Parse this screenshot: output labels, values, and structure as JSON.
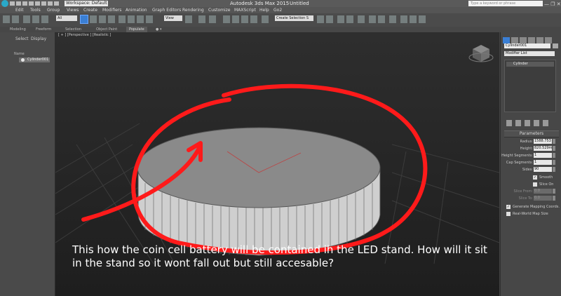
{
  "titlebar": {
    "workspace": "Workspace: Default",
    "app_title": "Autodesk 3ds Max  2015",
    "document": "Untitled",
    "search_placeholder": "Type a keyword or phrase",
    "window_controls": "— ❐ ✕"
  },
  "menu": [
    "Edit",
    "Tools",
    "Group",
    "Views",
    "Create",
    "Modifiers",
    "Animation",
    "Graph Editors",
    "Rendering",
    "Customize",
    "MAXScript",
    "Help",
    "Go2"
  ],
  "toolbar": {
    "selection_filter": "All",
    "reference_coord": "View",
    "named_selection": "Create Selection S"
  },
  "ribbon": {
    "tabs": [
      "Modeling",
      "Freeform",
      "Selection",
      "Object Paint",
      "Populate"
    ],
    "active": "Populate"
  },
  "scene_explorer": {
    "tabs": [
      "Select",
      "Display"
    ],
    "column": "Name",
    "objects": [
      "Cylinder001"
    ]
  },
  "viewport": {
    "label": "[ + ] [Perspective ] [Realistic ]",
    "annotation": "This how the coin cell battery will be contained ih the LED stand. How will it sit in the stand so it wont fall out but still accesable?",
    "annotation_color": "#ff1a1a"
  },
  "command_panel": {
    "object_name": "Cylinder001",
    "modifier_list": "Modifier List",
    "stack": [
      "Cylinder"
    ],
    "rollout": "Parameters",
    "params": [
      {
        "label": "Radius:",
        "value": "1588.753"
      },
      {
        "label": "Height:",
        "value": "820.529m"
      },
      {
        "label": "Height Segments:",
        "value": "1"
      },
      {
        "label": "Cap Segments:",
        "value": "1"
      },
      {
        "label": "Sides:",
        "value": "90"
      }
    ],
    "smooth": {
      "label": "Smooth",
      "checked": "✓"
    },
    "slice_on": {
      "label": "Slice On",
      "checked": ""
    },
    "slice_from": {
      "label": "Slice From:",
      "value": "0.0"
    },
    "slice_to": {
      "label": "Slice To:",
      "value": "0.0"
    },
    "gen_mapping": {
      "label": "Generate Mapping Coords.",
      "checked": "✓"
    },
    "real_world": {
      "label": "Real-World Map Size",
      "checked": ""
    }
  }
}
